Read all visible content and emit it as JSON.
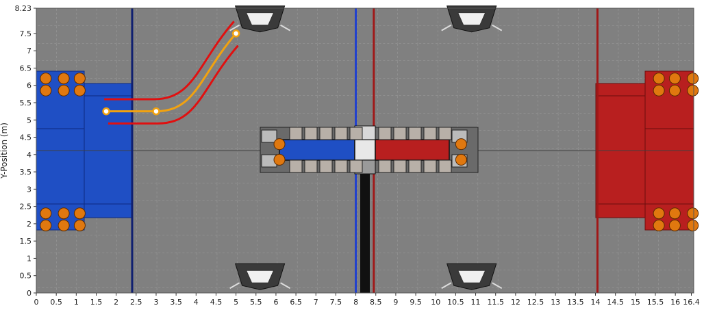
{
  "plot": {
    "y_axis_label": "Y-Position (m)",
    "x_ticks": [
      "0",
      "0.5",
      "1",
      "1.5",
      "2",
      "2.5",
      "3",
      "3.5",
      "4",
      "4.5",
      "5",
      "5.5",
      "6",
      "6.5",
      "7",
      "7.5",
      "8",
      "8.5",
      "9",
      "9.5",
      "10",
      "10.5",
      "11",
      "11.5",
      "12",
      "12.5",
      "13",
      "13.5",
      "14",
      "14.5",
      "15",
      "15.5",
      "16",
      "16.4"
    ],
    "y_ticks": [
      "0",
      "0.5",
      "1",
      "1.5",
      "2",
      "2.5",
      "3",
      "3.5",
      "4",
      "4.5",
      "5",
      "5.5",
      "6",
      "6.5",
      "7",
      "7.5",
      "8.23"
    ],
    "x_range": [
      0,
      16.46
    ],
    "y_range": [
      0,
      8.23
    ],
    "colors": {
      "field": "#808080",
      "blue_alliance": "#1f4fc4",
      "red_alliance": "#b81f1f",
      "path": "#f2a20f",
      "path_bounds": "#e01010",
      "cargo": "#e0780f"
    }
  },
  "path": {
    "waypoints": [
      {
        "x": 1.75,
        "y": 5.25
      },
      {
        "x": 3.0,
        "y": 5.25
      },
      {
        "x": 5.0,
        "y": 7.5
      }
    ],
    "bounds_offset_m": 0.3
  },
  "field": {
    "lines": [
      {
        "name": "blue-community-line",
        "x": 2.4,
        "color": "#102070"
      },
      {
        "name": "blue-center-line",
        "x": 8.0,
        "color": "#1f3fcf"
      },
      {
        "name": "red-center-line",
        "x": 8.45,
        "color": "#a01818"
      },
      {
        "name": "red-community-line",
        "x": 14.05,
        "color": "#a01818"
      }
    ],
    "cargo_positions": [
      [
        0.1,
        6.2
      ],
      [
        0.55,
        6.2
      ],
      [
        0.95,
        6.2
      ],
      [
        0.1,
        5.85
      ],
      [
        0.55,
        5.85
      ],
      [
        0.95,
        5.85
      ],
      [
        0.1,
        2.3
      ],
      [
        0.55,
        2.3
      ],
      [
        0.95,
        2.3
      ],
      [
        0.1,
        1.95
      ],
      [
        0.55,
        1.95
      ],
      [
        0.95,
        1.95
      ],
      [
        15.45,
        6.2
      ],
      [
        15.85,
        6.2
      ],
      [
        16.3,
        6.2
      ],
      [
        15.45,
        5.85
      ],
      [
        15.85,
        5.85
      ],
      [
        16.3,
        5.85
      ],
      [
        15.45,
        2.3
      ],
      [
        15.85,
        2.3
      ],
      [
        16.3,
        2.3
      ],
      [
        15.45,
        1.95
      ],
      [
        15.85,
        1.95
      ],
      [
        16.3,
        1.95
      ],
      [
        5.95,
        4.3
      ],
      [
        5.95,
        3.85
      ],
      [
        10.5,
        4.3
      ],
      [
        10.5,
        3.85
      ]
    ],
    "hoppers": [
      {
        "x": 5.6,
        "y": 7.9
      },
      {
        "x": 10.9,
        "y": 7.9
      },
      {
        "x": 5.6,
        "y": 0.45
      },
      {
        "x": 10.9,
        "y": 0.45
      }
    ]
  }
}
